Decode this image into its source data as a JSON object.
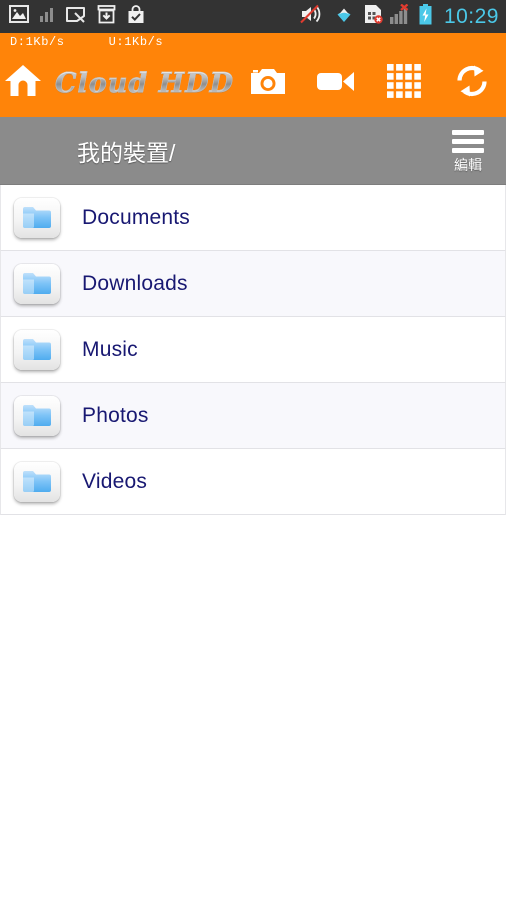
{
  "status_bar": {
    "background": "#333333",
    "clock": "10:29",
    "clock_color": "#4bc8e8",
    "left_icons": [
      {
        "name": "gallery-image-icon"
      },
      {
        "name": "signal-bars-icon"
      },
      {
        "name": "screen-capture-icon"
      },
      {
        "name": "download-box-icon"
      },
      {
        "name": "play-store-bag-icon"
      }
    ],
    "right_icons": [
      {
        "name": "volume-mute-icon"
      },
      {
        "name": "wifi-icon"
      },
      {
        "name": "sim-card-error-icon"
      },
      {
        "name": "cellular-signal-error-icon"
      },
      {
        "name": "battery-charging-icon"
      }
    ]
  },
  "net_speed": {
    "background": "#ff8409",
    "download": "D:1Kb/s",
    "upload": "U:1Kb/s"
  },
  "toolbar": {
    "background": "#ff8409",
    "app_title": "Cloud HDD",
    "home_icon": "home-icon",
    "buttons": [
      {
        "name": "camera-button",
        "icon": "camera-icon"
      },
      {
        "name": "video-button",
        "icon": "video-camera-icon"
      },
      {
        "name": "grid-view-button",
        "icon": "grid-icon"
      },
      {
        "name": "refresh-button",
        "icon": "refresh-sync-icon"
      }
    ]
  },
  "breadcrumb": {
    "background": "#8b8b8b",
    "path": "我的裝置/",
    "menu_label": "編輯",
    "menu_icon": "hamburger-menu-icon"
  },
  "file_list": {
    "text_color": "#181872",
    "items": [
      {
        "name": "Documents",
        "icon": "folder-icon"
      },
      {
        "name": "Downloads",
        "icon": "folder-icon"
      },
      {
        "name": "Music",
        "icon": "folder-icon"
      },
      {
        "name": "Photos",
        "icon": "folder-icon"
      },
      {
        "name": "Videos",
        "icon": "folder-icon"
      }
    ]
  }
}
